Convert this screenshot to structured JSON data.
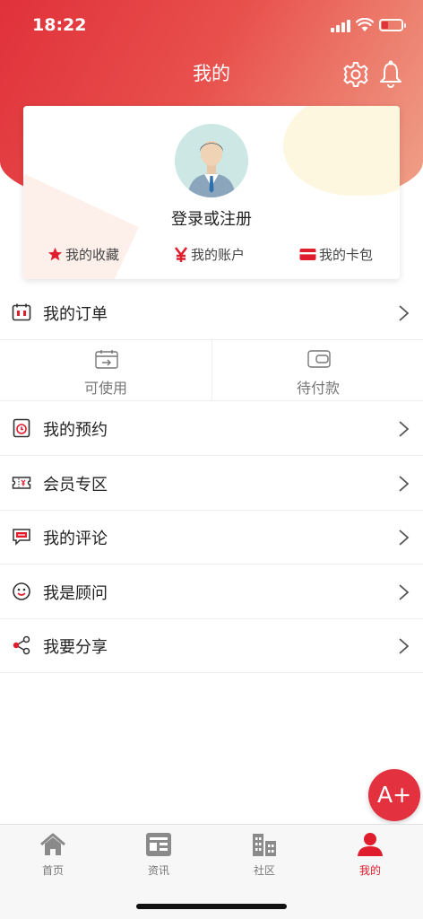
{
  "status_bar": {
    "time": "18:22"
  },
  "header": {
    "title": "我的",
    "settings_icon": "gear-icon",
    "notify_icon": "bell-icon"
  },
  "profile": {
    "login_label": "登录或注册",
    "quick_links": [
      {
        "label": "我的收藏",
        "icon": "star-icon"
      },
      {
        "label": "我的账户",
        "icon": "yen-icon"
      },
      {
        "label": "我的卡包",
        "icon": "card-icon"
      }
    ]
  },
  "orders": {
    "label": "我的订单",
    "sub": [
      {
        "label": "可使用",
        "icon": "calendar-icon"
      },
      {
        "label": "待付款",
        "icon": "wallet-icon"
      }
    ]
  },
  "menu": [
    {
      "label": "我的预约",
      "icon": "clock-icon"
    },
    {
      "label": "会员专区",
      "icon": "ticket-icon"
    },
    {
      "label": "我的评论",
      "icon": "comment-icon"
    },
    {
      "label": "我是顾问",
      "icon": "smile-icon"
    },
    {
      "label": "我要分享",
      "icon": "share-icon"
    }
  ],
  "fab": {
    "label": "A+"
  },
  "tabs": [
    {
      "label": "首页",
      "icon": "home-icon",
      "active": false
    },
    {
      "label": "资讯",
      "icon": "news-icon",
      "active": false
    },
    {
      "label": "社区",
      "icon": "buildings-icon",
      "active": false
    },
    {
      "label": "我的",
      "icon": "user-icon",
      "active": true
    }
  ],
  "colors": {
    "accent": "#e01d2d",
    "header_start": "#e0313a",
    "header_end": "#f0a48a"
  }
}
